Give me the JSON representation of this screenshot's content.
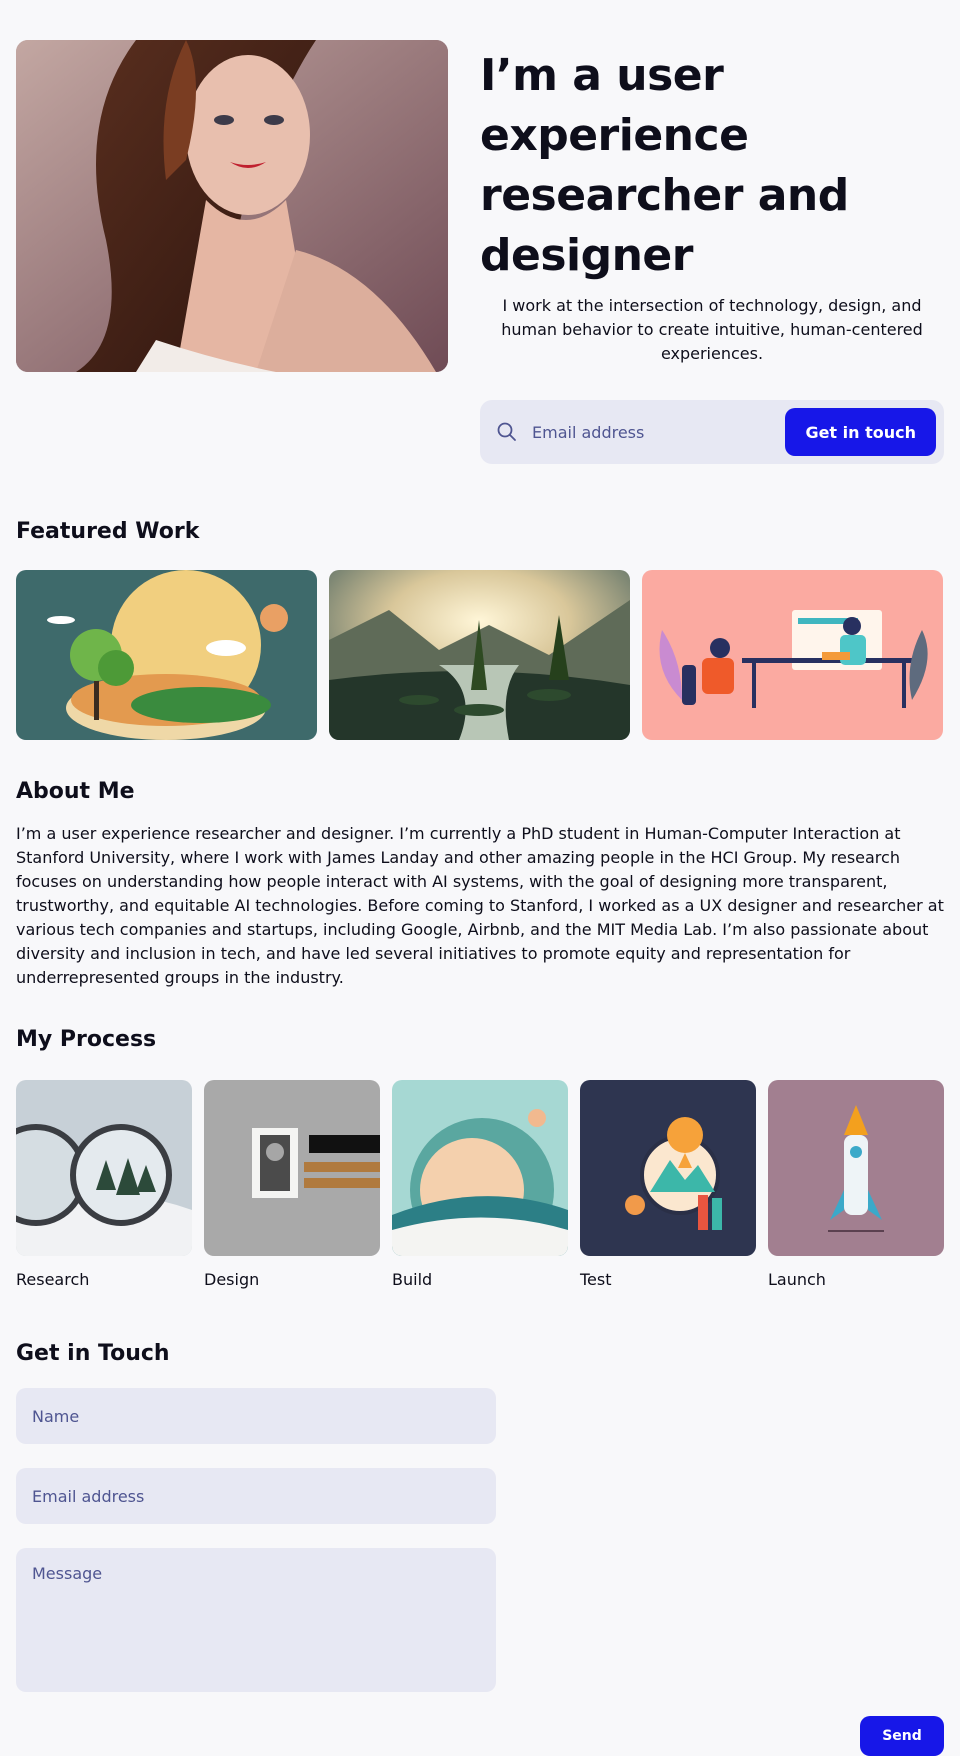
{
  "hero": {
    "title": "I’m a user experience\n researcher and\ndesigner",
    "subtitle": "I work at the intersection of technology, design, and human behavior to create intuitive, human-centered experiences.",
    "email_placeholder": "Email address",
    "cta_label": "Get in touch",
    "accent_color": "#1717e8"
  },
  "featured": {
    "title": "Featured Work"
  },
  "about": {
    "title": "About Me",
    "text": "I’m a user experience researcher and designer. I’m currently a PhD student in Human-Computer Interaction at Stanford University, where I work with James Landay and other amazing people in the HCI Group. My research focuses on understanding how people interact with AI systems, with the goal of designing more transparent, trustworthy, and equitable AI technologies. Before coming to Stanford, I worked as a UX designer and researcher at various tech companies and startups, including Google, Airbnb, and the MIT Media Lab. I’m also passionate about diversity and inclusion in tech, and have led several initiatives to promote equity and representation for underrepresented groups in the industry."
  },
  "process": {
    "title": "My Process",
    "steps": [
      {
        "label": "Research"
      },
      {
        "label": "Design"
      },
      {
        "label": "Build"
      },
      {
        "label": "Test"
      },
      {
        "label": "Launch"
      }
    ]
  },
  "contact": {
    "title": "Get in Touch",
    "name_placeholder": "Name",
    "email_placeholder": "Email address",
    "message_placeholder": "Message",
    "send_label": "Send"
  }
}
